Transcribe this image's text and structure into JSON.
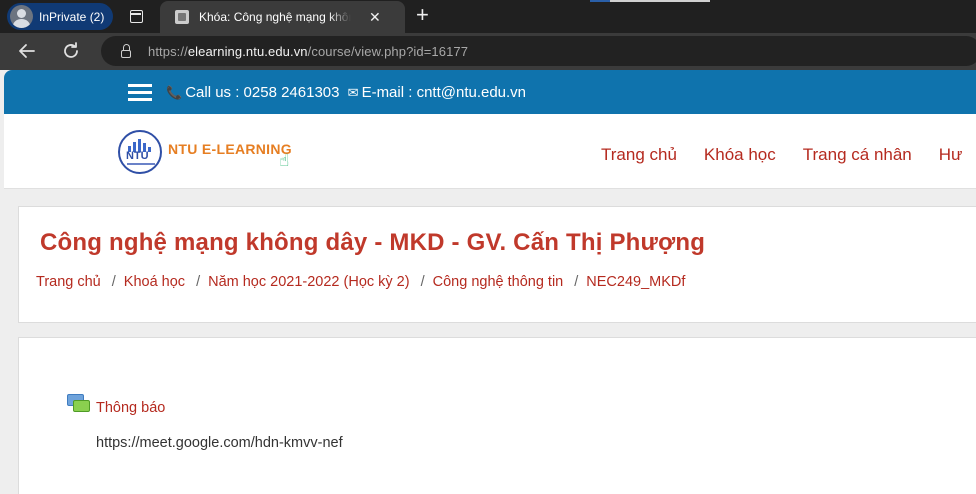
{
  "browser": {
    "profile_label": "InPrivate (2)",
    "tab_title": "Khóa: Công nghệ mạng không dây - MKD",
    "url_prefix": "https://",
    "url_domain": "elearning.ntu.edu.vn",
    "url_path": "/course/view.php?id=16177"
  },
  "topbar": {
    "contact": "Call us : 0258 2461303",
    "email": "E-mail : cntt@ntu.edu.vn"
  },
  "header": {
    "logo_seal_text": "NTU",
    "logo_text": "NTU E-LEARNING",
    "menu": [
      "Trang chủ",
      "Khóa học",
      "Trang cá nhân",
      "Hư"
    ]
  },
  "course": {
    "title": "Công nghệ mạng không dây - MKD - GV. Cấn Thị Phượng",
    "breadcrumb": [
      "Trang chủ",
      "Khoá học",
      "Năm học 2021-2022 (Học kỳ 2)",
      "Công nghệ thông tin",
      "NEC249_MKDf"
    ]
  },
  "content": {
    "forum_label": "Thông báo",
    "meet_link": "https://meet.google.com/hdn-kmvv-nef"
  },
  "colors": {
    "topbar": "#0f73ad",
    "link": "#b52a1f",
    "title": "#c0392b",
    "brand": "#e67e22"
  }
}
